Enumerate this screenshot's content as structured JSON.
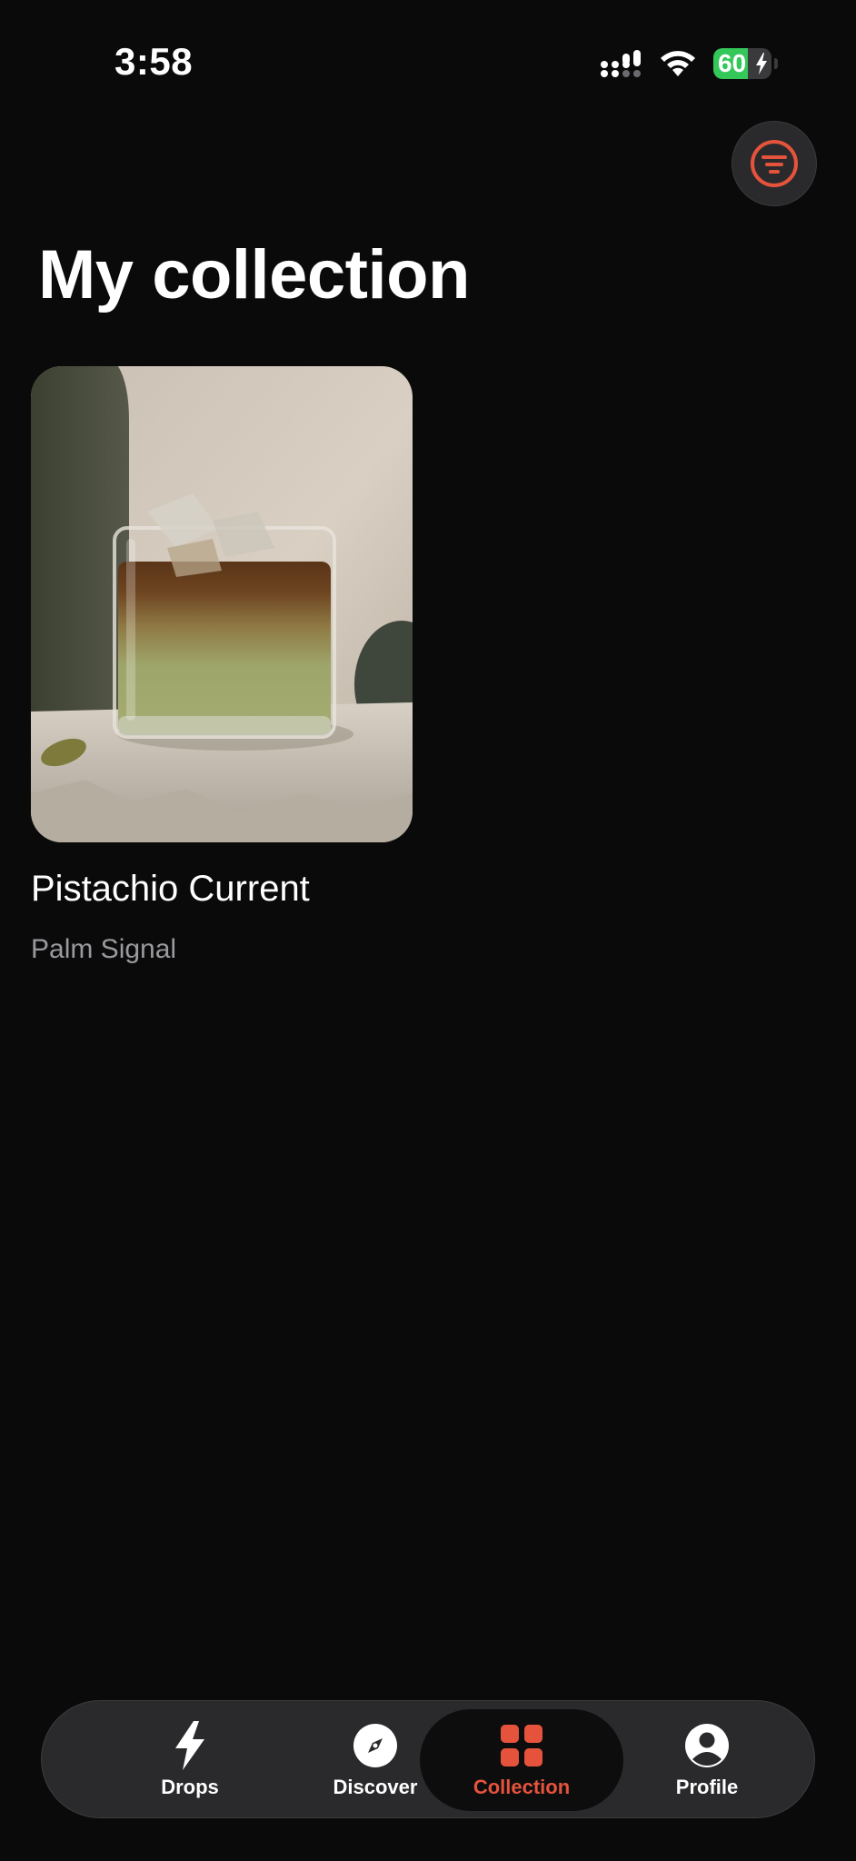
{
  "status_bar": {
    "time": "3:58",
    "battery_level": "60",
    "battery_fraction": 0.6,
    "charging": true
  },
  "colors": {
    "accent": "#e5533c",
    "background": "#0a0a0b",
    "battery_green": "#34c759"
  },
  "header": {
    "title": "My collection",
    "filter_icon": "filter-icon"
  },
  "collection": {
    "items": [
      {
        "title": "Pistachio Current",
        "subtitle": "Palm Signal",
        "image": "iced-pistachio-latte-photo"
      }
    ]
  },
  "tab_bar": {
    "selected": "Collection",
    "tabs": [
      {
        "label": "Drops",
        "icon": "bolt-icon"
      },
      {
        "label": "Discover",
        "icon": "compass-icon"
      },
      {
        "label": "Collection",
        "icon": "grid-icon"
      },
      {
        "label": "Profile",
        "icon": "profile-icon"
      }
    ]
  }
}
